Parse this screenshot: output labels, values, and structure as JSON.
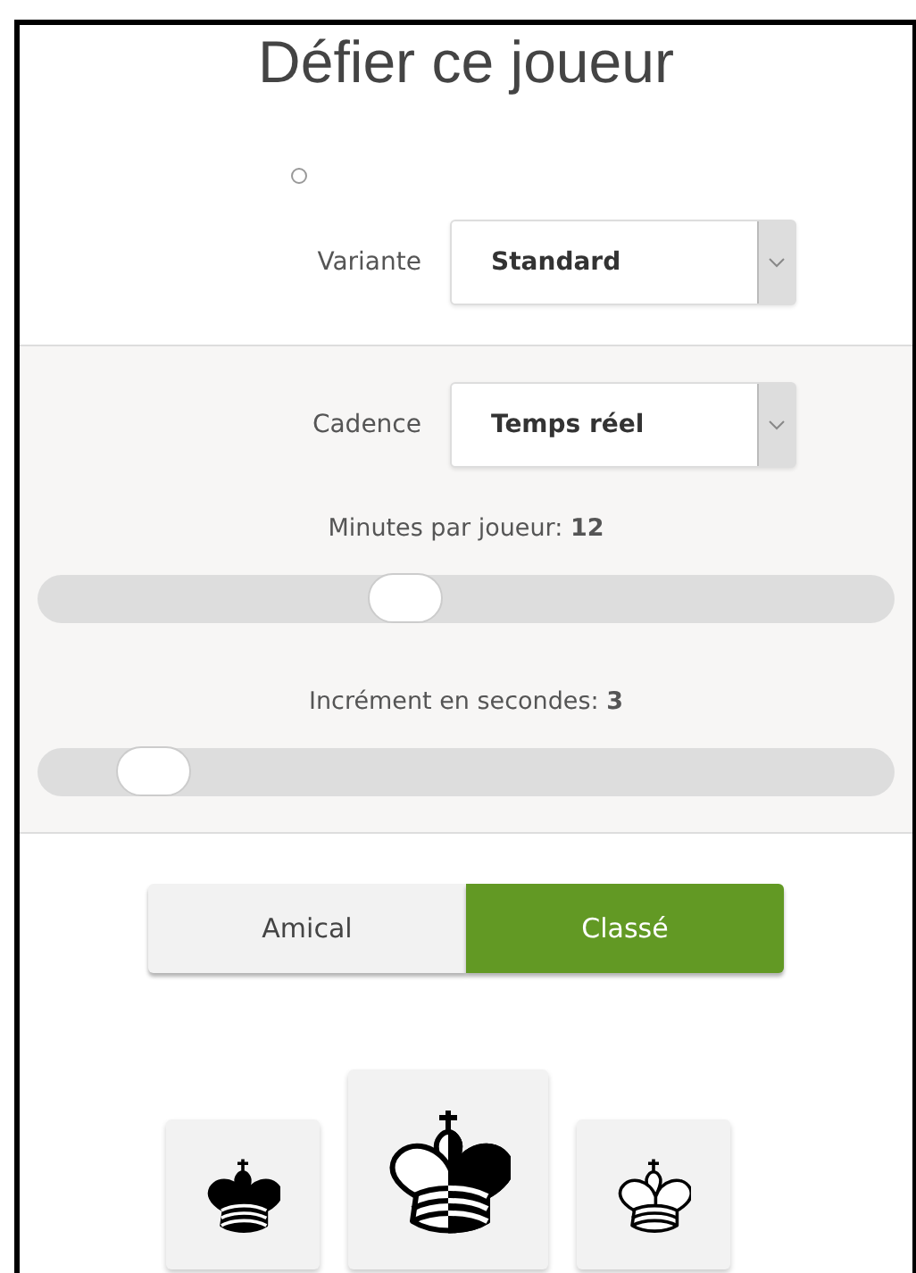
{
  "title": "Défier ce joueur",
  "radio": {
    "checked": false
  },
  "variant": {
    "label": "Variante",
    "value": "Standard"
  },
  "time_control": {
    "label": "Cadence",
    "value": "Temps réel"
  },
  "sliders": [
    {
      "label": "Minutes par joueur: **12**",
      "level": 0.43
    },
    {
      "label": "Incrément en secondes: **3**",
      "level": 0.135
    }
  ],
  "modes": [
    {
      "label": "Amical",
      "selected": false
    },
    {
      "label": "Classé",
      "selected": true
    }
  ],
  "colors": [
    {
      "kind": "black"
    },
    {
      "kind": "random"
    },
    {
      "kind": "white"
    }
  ]
}
